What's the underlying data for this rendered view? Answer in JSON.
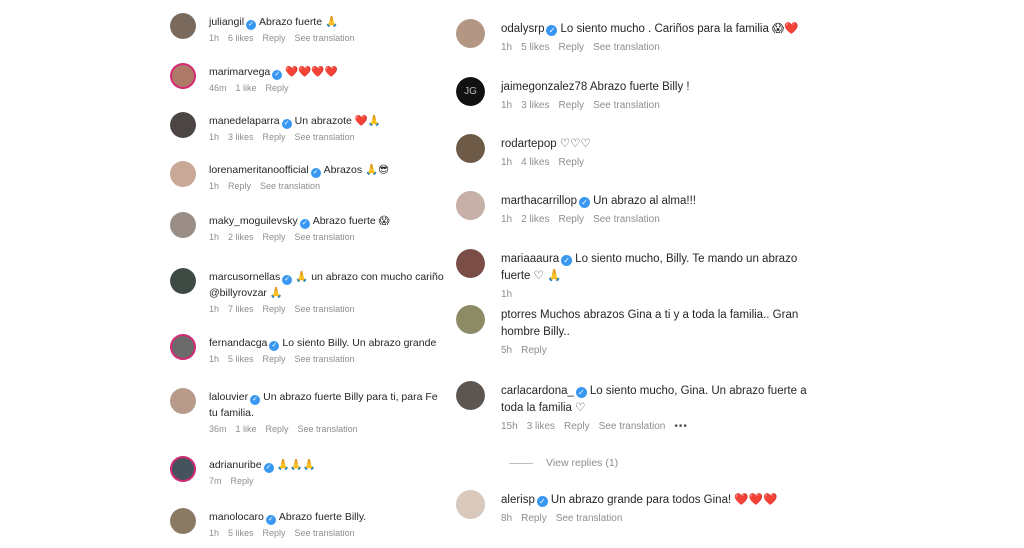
{
  "left_comments": [
    {
      "user": "juliangil",
      "verified": true,
      "text": "Abrazo fuerte 🙏",
      "time": "1h",
      "likes": "6 likes",
      "reply": "Reply",
      "translation": "See translation",
      "ring": false,
      "avatar": "#7a6a5e"
    },
    {
      "user": "marimarvega",
      "verified": true,
      "text": "❤️❤️❤️❤️",
      "time": "46m",
      "likes": "1 like",
      "reply": "Reply",
      "translation": "",
      "ring": true,
      "avatar": "#b07a6a"
    },
    {
      "user": "manedelaparra",
      "verified": true,
      "text": "Un abrazote ❤️🙏",
      "time": "1h",
      "likes": "3 likes",
      "reply": "Reply",
      "translation": "See translation",
      "ring": false,
      "avatar": "#4b4643"
    },
    {
      "user": "lorenameritanoofficial",
      "verified": true,
      "text": "Abrazos 🙏😎",
      "time": "1h",
      "likes": "",
      "reply": "Reply",
      "translation": "See translation",
      "ring": false,
      "avatar": "#c9a898"
    },
    {
      "user": "maky_moguilevsky",
      "verified": true,
      "text": "Abrazo fuerte 😱",
      "time": "1h",
      "likes": "2 likes",
      "reply": "Reply",
      "translation": "See translation",
      "ring": false,
      "avatar": "#9a8e86"
    },
    {
      "user": "marcusornellas",
      "verified": true,
      "text": "🙏 un abrazo con mucho cariño",
      "text2": "@billyrovzar 🙏",
      "time": "1h",
      "likes": "7 likes",
      "reply": "Reply",
      "translation": "See translation",
      "ring": false,
      "avatar": "#3e4a44"
    },
    {
      "user": "fernandacga",
      "verified": true,
      "text": "Lo siento Billy. Un abrazo grande",
      "time": "1h",
      "likes": "5 likes",
      "reply": "Reply",
      "translation": "See translation",
      "ring": true,
      "avatar": "#6b6b6b"
    },
    {
      "user": "lalouvier",
      "verified": true,
      "text": "Un abrazo fuerte Billy para ti, para Fe",
      "text2": "tu familia.",
      "time": "36m",
      "likes": "1 like",
      "reply": "Reply",
      "translation": "See translation",
      "ring": false,
      "avatar": "#b89a8a"
    },
    {
      "user": "adrianuribe",
      "verified": true,
      "text": "🙏🙏🙏",
      "time": "7m",
      "likes": "",
      "reply": "Reply",
      "translation": "",
      "ring": true,
      "avatar": "#46525c"
    },
    {
      "user": "manolocaro",
      "verified": true,
      "text": "Abrazo fuerte Billy.",
      "time": "1h",
      "likes": "5 likes",
      "reply": "Reply",
      "translation": "See translation",
      "ring": false,
      "avatar": "#8a7a64"
    }
  ],
  "right_comments": [
    {
      "user": "odalysrp",
      "verified": true,
      "text": "Lo siento mucho . Cariños para la familia 😱❤️",
      "time": "1h",
      "likes": "5 likes",
      "reply": "Reply",
      "translation": "See translation",
      "avatar": "#b39684",
      "initials": ""
    },
    {
      "user": "jaimegonzalez78",
      "verified": false,
      "text": "Abrazo fuerte Billy !",
      "time": "1h",
      "likes": "3 likes",
      "reply": "Reply",
      "translation": "See translation",
      "avatar": "#111111",
      "initials": "JG"
    },
    {
      "user": "rodartepop",
      "verified": false,
      "text": "♡♡♡",
      "time": "1h",
      "likes": "4 likes",
      "reply": "Reply",
      "translation": "",
      "avatar": "#6d5b47",
      "initials": ""
    },
    {
      "user": "marthacarrillop",
      "verified": true,
      "text": "Un abrazo al alma!!!",
      "time": "1h",
      "likes": "2 likes",
      "reply": "Reply",
      "translation": "See translation",
      "avatar": "#c7b0a8",
      "initials": ""
    },
    {
      "user": "mariaaaura",
      "verified": true,
      "text": "Lo siento mucho, Billy. Te mando un abrazo",
      "text2": "fuerte ♡ 🙏",
      "time": "1h",
      "likes": "",
      "reply": "",
      "translation": "",
      "avatar": "#7a4e46",
      "initials": ""
    },
    {
      "user": "ptorres",
      "verified": false,
      "text": "Muchos abrazos Gina a ti y a toda la familia.. Gran",
      "text2": "hombre Billy..",
      "time": "5h",
      "likes": "",
      "reply": "Reply",
      "translation": "",
      "avatar": "#8d8a66",
      "initials": ""
    },
    {
      "user": "carlacardona_",
      "verified": true,
      "text": "Lo siento mucho, Gina. Un abrazo fuerte a",
      "text2": "toda la familia ♡",
      "time": "15h",
      "likes": "3 likes",
      "reply": "Reply",
      "translation": "See translation",
      "more": "•••",
      "avatar": "#5d5550",
      "initials": ""
    },
    {
      "user": "alerisp",
      "verified": true,
      "text": "Un abrazo grande para todos Gina! ❤️❤️❤️",
      "time": "8h",
      "likes": "",
      "reply": "Reply",
      "translation": "See translation",
      "avatar": "#d9c8bc",
      "initials": ""
    }
  ],
  "view_replies": "View replies (1)",
  "colors": {
    "verified": "#3897f0",
    "story_ring": "#d62976",
    "meta": "#8e8e8e",
    "text": "#262626"
  }
}
